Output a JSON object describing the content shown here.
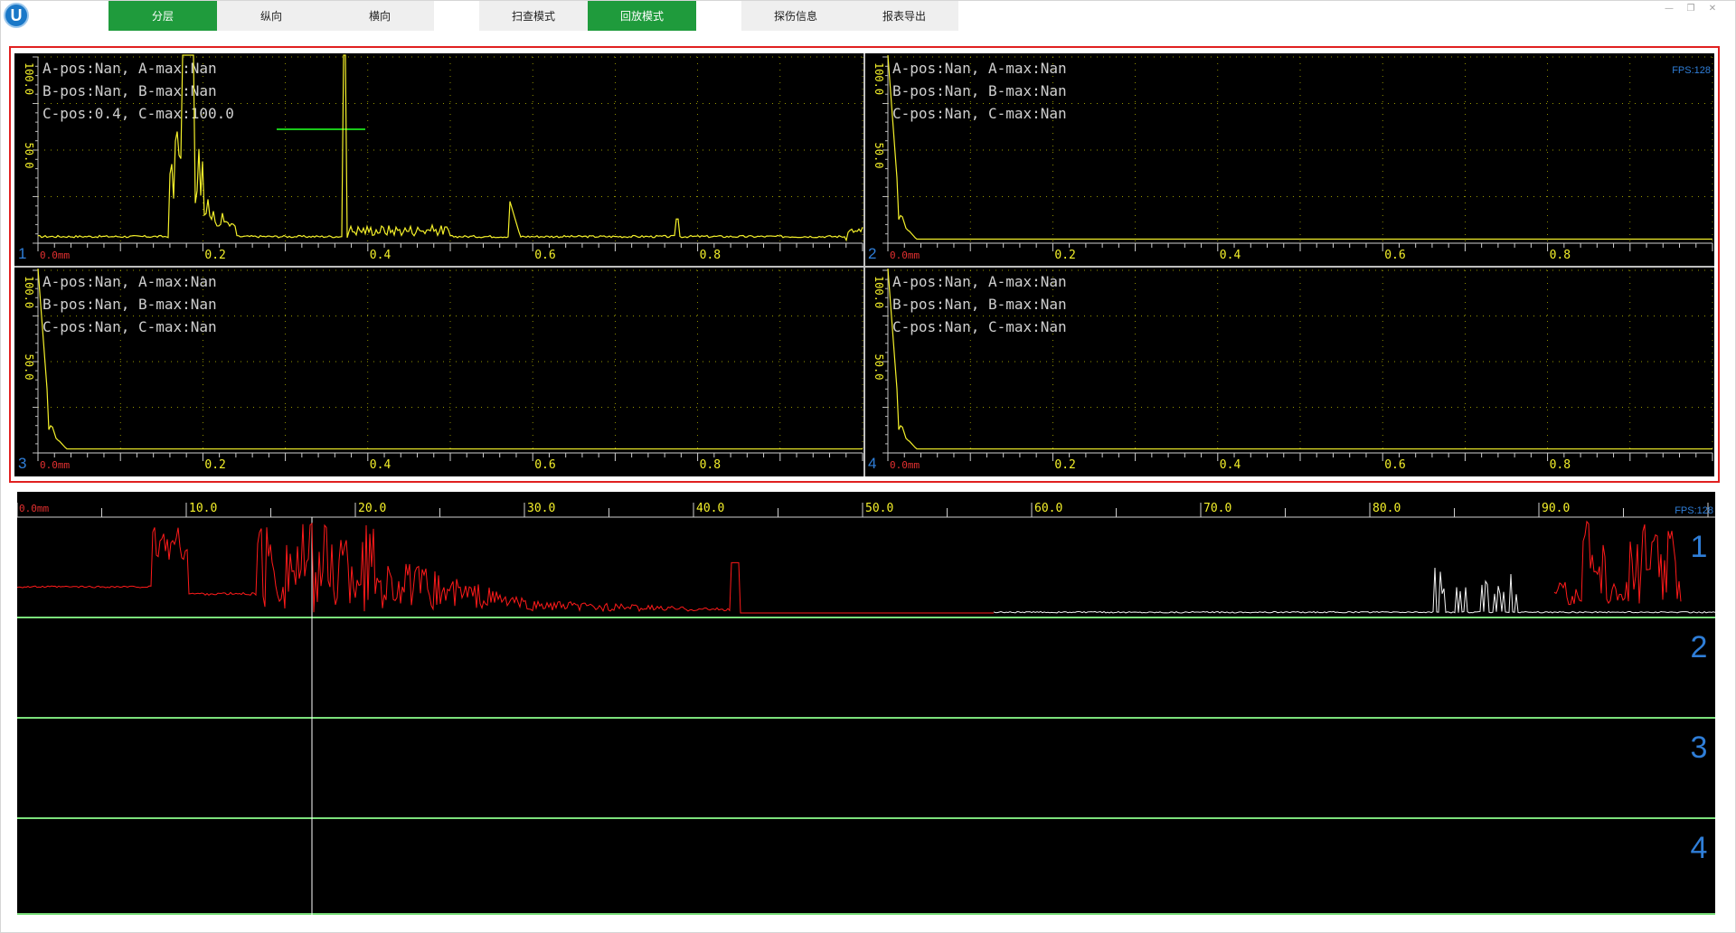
{
  "app": {
    "logo_letter": "U",
    "tabs": [
      {
        "label": "分层",
        "active": true
      },
      {
        "label": "纵向",
        "active": false
      },
      {
        "label": "横向",
        "active": false
      },
      {
        "label": "扫查模式",
        "active": false
      },
      {
        "label": "回放模式",
        "active": true
      },
      {
        "label": "探伤信息",
        "active": false
      },
      {
        "label": "报表导出",
        "active": false
      }
    ],
    "window_controls": {
      "minimize": "—",
      "restore": "❐",
      "close": "✕"
    }
  },
  "colors": {
    "trace_yellow": "#f4f02a",
    "grid_dot": "#c8c800",
    "label_gray": "#cfcfcf",
    "channel_blue": "#2f7ed8",
    "gate_green": "#19c819",
    "bscan_red": "#ff1a1a",
    "bscan_white": "#f2f2f2",
    "divider_green": "#7be07b",
    "frame_red": "#e02020"
  },
  "ascan": {
    "fps": "FPS:128",
    "y_ticks": [
      "100.0",
      "50.0"
    ],
    "x_origin": "0.0mm",
    "x_ticks": [
      "0.2",
      "0.4",
      "0.6",
      "0.8"
    ],
    "panels": [
      {
        "channel": "1",
        "lines": [
          "A-pos:Nan, A-max:Nan",
          "B-pos:Nan, B-max:Nan",
          "C-pos:0.4, C-max:100.0"
        ]
      },
      {
        "channel": "2",
        "lines": [
          "A-pos:Nan, A-max:Nan",
          "B-pos:Nan, B-max:Nan",
          "C-pos:Nan, C-max:Nan"
        ]
      },
      {
        "channel": "3",
        "lines": [
          "A-pos:Nan, A-max:Nan",
          "B-pos:Nan, B-max:Nan",
          "C-pos:Nan, C-max:Nan"
        ]
      },
      {
        "channel": "4",
        "lines": [
          "A-pos:Nan, A-max:Nan",
          "B-pos:Nan, B-max:Nan",
          "C-pos:Nan, C-max:Nan"
        ]
      }
    ]
  },
  "bscan": {
    "fps": "FPS:128",
    "x_origin": "0.0mm",
    "x_ticks": [
      "10.0",
      "20.0",
      "30.0",
      "40.0",
      "50.0",
      "60.0",
      "70.0",
      "80.0",
      "90.0"
    ],
    "rows": [
      "1",
      "2",
      "3",
      "4"
    ]
  }
}
